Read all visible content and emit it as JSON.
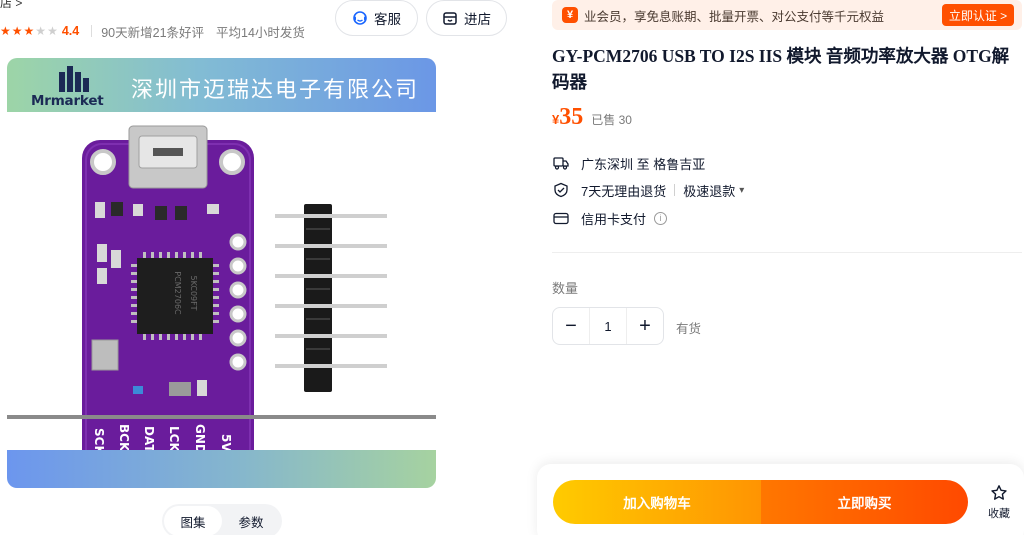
{
  "store": {
    "crumb": "店 >",
    "rating": "4.4",
    "stars_filled": 3,
    "stars_total": 5,
    "review_stat": "90天新增21条好评",
    "ship_stat": "平均14小时发货",
    "btn_service": "客服",
    "btn_shop": "进店"
  },
  "gallery": {
    "logo_text": "Mrmarket",
    "company_name": "深圳市迈瑞达电子有限公司",
    "pin_labels": [
      "SCK",
      "BCK",
      "DAT",
      "LCK",
      "GND",
      "5V"
    ],
    "chip_text": [
      "PCM2706C",
      "5KC09FT"
    ],
    "tabs": [
      "图集",
      "参数"
    ],
    "active_tab": 0
  },
  "vip": {
    "icon": "¥",
    "text": "业会员，享免息账期、批量开票、对公支付等千元权益",
    "button": "立即认证 >"
  },
  "product": {
    "title": "GY-PCM2706 USB TO I2S IIS 模块 音频功率放大器 OTG解码器",
    "currency": "¥",
    "price": "35",
    "sold": "已售 30",
    "shipping": "广东深圳 至 格鲁吉亚",
    "return_policy": "7天无理由退货",
    "fast_refund": "极速退款",
    "payment": "信用卡支付"
  },
  "quantity": {
    "label": "数量",
    "value": "1",
    "stock": "有货"
  },
  "actions": {
    "add_cart": "加入购物车",
    "buy_now": "立即购买",
    "favorite": "收藏"
  },
  "colors": {
    "accent": "#ff5000",
    "board_purple": "#6b1b9a",
    "cart_gradient": [
      "#ffcb00",
      "#ff9402"
    ],
    "buy_gradient": [
      "#ff7700",
      "#ff4900"
    ]
  }
}
